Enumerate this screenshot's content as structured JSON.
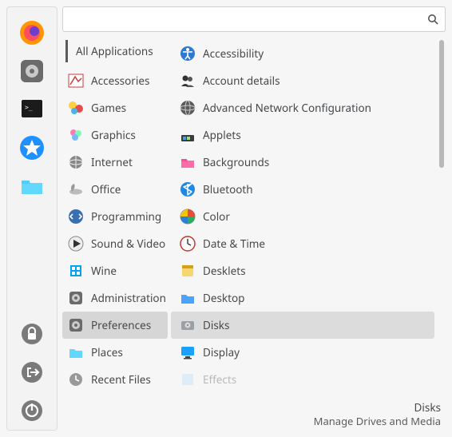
{
  "sidebar": {
    "items": [
      {
        "name": "firefox-icon"
      },
      {
        "name": "settings-icon"
      },
      {
        "name": "terminal-icon"
      },
      {
        "name": "software-center-icon"
      },
      {
        "name": "files-icon"
      }
    ],
    "bottom_items": [
      {
        "name": "lock-icon"
      },
      {
        "name": "logout-icon"
      },
      {
        "name": "power-icon"
      }
    ]
  },
  "search": {
    "placeholder": "",
    "value": ""
  },
  "categories": {
    "all_label": "All Applications",
    "items": [
      {
        "label": "Accessories",
        "icon": "accessories"
      },
      {
        "label": "Games",
        "icon": "games"
      },
      {
        "label": "Graphics",
        "icon": "graphics"
      },
      {
        "label": "Internet",
        "icon": "internet"
      },
      {
        "label": "Office",
        "icon": "office"
      },
      {
        "label": "Programming",
        "icon": "programming"
      },
      {
        "label": "Sound & Video",
        "icon": "multimedia"
      },
      {
        "label": "Wine",
        "icon": "wine"
      },
      {
        "label": "Administration",
        "icon": "administration"
      },
      {
        "label": "Preferences",
        "icon": "preferences",
        "selected": true
      },
      {
        "label": "Places",
        "icon": "places"
      },
      {
        "label": "Recent Files",
        "icon": "recent"
      }
    ]
  },
  "apps": {
    "items": [
      {
        "label": "Accessibility",
        "icon": "accessibility"
      },
      {
        "label": "Account details",
        "icon": "account"
      },
      {
        "label": "Advanced Network Configuration",
        "icon": "network"
      },
      {
        "label": "Applets",
        "icon": "applets"
      },
      {
        "label": "Backgrounds",
        "icon": "backgrounds"
      },
      {
        "label": "Bluetooth",
        "icon": "bluetooth"
      },
      {
        "label": "Color",
        "icon": "color"
      },
      {
        "label": "Date & Time",
        "icon": "clock"
      },
      {
        "label": "Desklets",
        "icon": "desklets"
      },
      {
        "label": "Desktop",
        "icon": "desktop"
      },
      {
        "label": "Disks",
        "icon": "disks",
        "selected": true
      },
      {
        "label": "Display",
        "icon": "display"
      },
      {
        "label": "Effects",
        "icon": "effects",
        "faded": true
      }
    ]
  },
  "footer": {
    "title": "Disks",
    "subtitle": "Manage Drives and Media"
  }
}
